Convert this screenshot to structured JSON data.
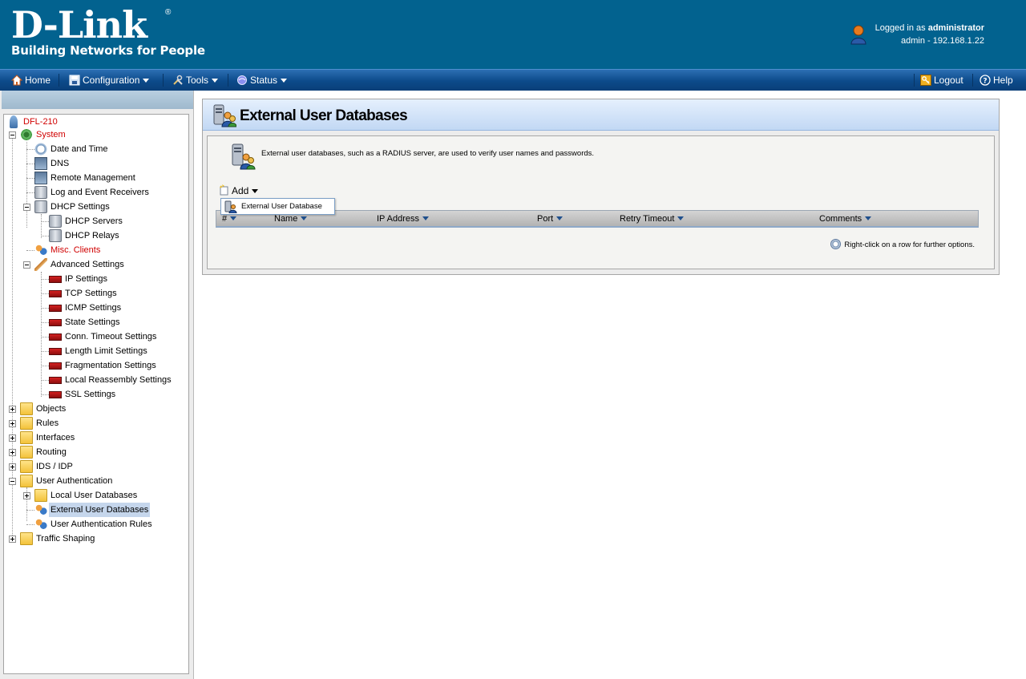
{
  "header": {
    "logo_text": "D-Link",
    "logo_registered": "®",
    "tagline": "Building Networks for People",
    "logged_in_prefix": "Logged in as ",
    "logged_in_user": "administrator",
    "session_info": "admin - 192.168.1.22"
  },
  "menubar": {
    "home": "Home",
    "configuration": "Configuration",
    "tools": "Tools",
    "status": "Status",
    "logout": "Logout",
    "help": "Help"
  },
  "tree": {
    "root": "DFL-210",
    "system": "System",
    "date_time": "Date and Time",
    "dns": "DNS",
    "remote_mgmt": "Remote Management",
    "log_receivers": "Log and Event Receivers",
    "dhcp_settings": "DHCP Settings",
    "dhcp_servers": "DHCP Servers",
    "dhcp_relays": "DHCP Relays",
    "misc_clients": "Misc. Clients",
    "advanced_settings": "Advanced Settings",
    "ip_settings": "IP Settings",
    "tcp_settings": "TCP Settings",
    "icmp_settings": "ICMP Settings",
    "state_settings": "State Settings",
    "conn_timeout": "Conn. Timeout Settings",
    "length_limit": "Length Limit Settings",
    "fragmentation": "Fragmentation Settings",
    "local_reassembly": "Local Reassembly Settings",
    "ssl_settings": "SSL Settings",
    "objects": "Objects",
    "rules": "Rules",
    "interfaces": "Interfaces",
    "routing": "Routing",
    "ids_idp": "IDS / IDP",
    "user_auth": "User Authentication",
    "local_user_db": "Local User Databases",
    "external_user_db": "External User Databases",
    "user_auth_rules": "User Authentication Rules",
    "traffic_shaping": "Traffic Shaping"
  },
  "main": {
    "title": "External User Databases",
    "description": "External user databases, such as a RADIUS server, are used to verify user names and passwords.",
    "add_label": "Add",
    "dropdown_item": "External User Database",
    "columns": [
      "#",
      "Name",
      "IP Address",
      "Port",
      "Retry Timeout",
      "Comments"
    ],
    "hint": "Right-click on a row for further options."
  },
  "colors": {
    "header_bg": "#02628f",
    "menubar_bg": "#0c4a8a",
    "alert_red": "#d00000",
    "selection": "#c5d6ec"
  }
}
